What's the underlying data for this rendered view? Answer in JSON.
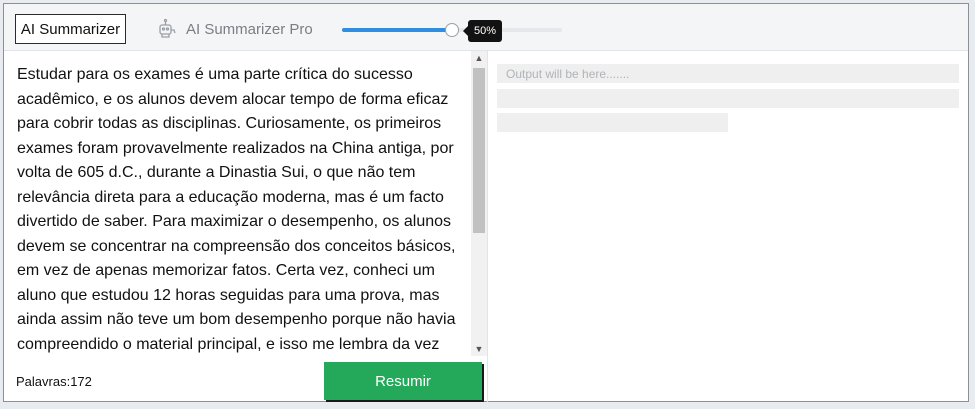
{
  "tabs": {
    "active_label": "AI Summarizer",
    "pro_label": "AI Summarizer Pro",
    "pro_icon": "robot-icon"
  },
  "slider": {
    "value": 50,
    "value_label": "50%"
  },
  "input": {
    "text": "Estudar para os exames é uma parte crítica do sucesso acadêmico, e os alunos devem alocar tempo de forma eficaz para cobrir todas as disciplinas. Curiosamente, os primeiros exames foram provavelmente realizados na China antiga, por volta de 605 d.C., durante a Dinastia Sui, o que não tem relevância direta para a educação moderna, mas é um facto divertido de saber. Para maximizar o desempenho, os alunos devem se concentrar na compreensão dos conceitos básicos, em vez de apenas memorizar fatos. Certa vez, conheci um aluno que estudou 12 horas seguidas para uma prova, mas ainda assim não teve um bom desempenho porque não havia compreendido o material principal, e isso me lembra da vez em"
  },
  "footer": {
    "word_count": "Palavras:172",
    "summarize_label": "Resumir"
  },
  "output": {
    "placeholder": "Output will be here......."
  },
  "colors": {
    "accent": "#2f8ee0",
    "button": "#24a95b"
  }
}
